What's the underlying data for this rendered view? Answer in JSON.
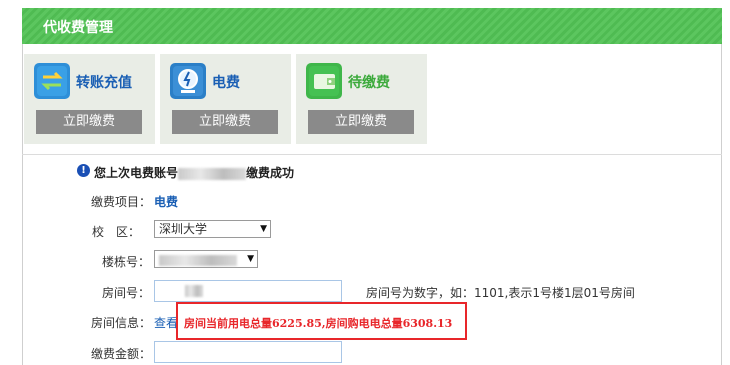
{
  "header": {
    "title": "代收费管理"
  },
  "tiles": [
    {
      "label": "转账充值",
      "button": "立即缴费",
      "icon": "transfer-icon",
      "color": "#1a5fb4"
    },
    {
      "label": "电费",
      "button": "立即缴费",
      "icon": "electricity-meter-icon",
      "color": "#1a5fb4"
    },
    {
      "label": "待缴费",
      "button": "立即缴费",
      "icon": "wallet-icon",
      "color": "#3caa3c"
    }
  ],
  "notice": {
    "prefix": "您上次电费账号",
    "suffix": "缴费成功",
    "icon": "info-icon"
  },
  "form": {
    "item_label": "缴费项目：",
    "item_value": "电费",
    "campus_label": "校　区：",
    "campus_value": "深圳大学",
    "building_label": "楼栋号：",
    "room_label": "房间号：",
    "room_hint": "房间号为数字，如：1101,表示1号楼1层01号房间",
    "roominfo_label": "房间信息：",
    "roominfo_link": "查看",
    "amount_label": "缴费金额："
  },
  "popup": {
    "text": "房间当前用电总量6225.85,房间购电电总量6308.13"
  }
}
